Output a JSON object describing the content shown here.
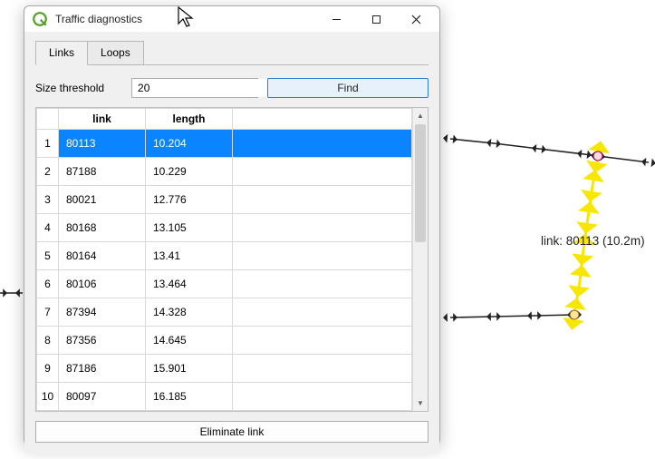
{
  "window": {
    "title": "Traffic diagnostics"
  },
  "tabs": {
    "links": "Links",
    "loops": "Loops"
  },
  "threshold": {
    "label": "Size threshold",
    "value": "20",
    "find": "Find"
  },
  "table": {
    "headers": {
      "link": "link",
      "length": "length"
    },
    "rows": [
      {
        "n": "1",
        "link": "80113",
        "length": "10.204"
      },
      {
        "n": "2",
        "link": "87188",
        "length": "10.229"
      },
      {
        "n": "3",
        "link": "80021",
        "length": "12.776"
      },
      {
        "n": "4",
        "link": "80168",
        "length": "13.105"
      },
      {
        "n": "5",
        "link": "80164",
        "length": "13.41"
      },
      {
        "n": "6",
        "link": "80106",
        "length": "13.464"
      },
      {
        "n": "7",
        "link": "87394",
        "length": "14.328"
      },
      {
        "n": "8",
        "link": "87356",
        "length": "14.645"
      },
      {
        "n": "9",
        "link": "87186",
        "length": "15.901"
      },
      {
        "n": "10",
        "link": "80097",
        "length": "16.185"
      }
    ],
    "selected_index": 0
  },
  "buttons": {
    "eliminate": "Eliminate link"
  },
  "map": {
    "tooltip": "link: 80113  (10.2m)"
  },
  "colors": {
    "selection": "#0a84ff",
    "highlight_link": "#f7e600"
  }
}
